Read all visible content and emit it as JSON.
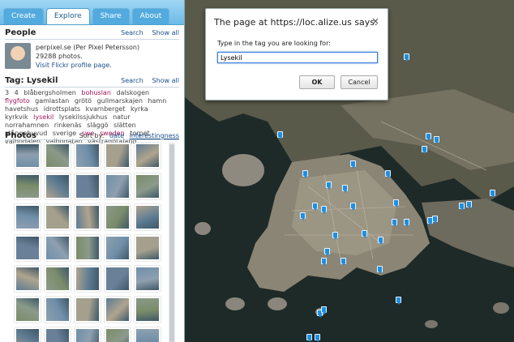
{
  "tabs": [
    "Create",
    "Explore",
    "Share",
    "About"
  ],
  "people": {
    "title": "People",
    "search": "Search",
    "show_all": "Show all",
    "user": "perpixel.se (Per Pixel Petersson)",
    "count": "29288 photos.",
    "profile_link": "Visit Flickr profile page."
  },
  "tag": {
    "title": "Tag: Lysekil",
    "search": "Search",
    "show_all": "Show all",
    "cloud": [
      {
        "t": "3",
        "hot": false
      },
      {
        "t": "4",
        "hot": false
      },
      {
        "t": "blåbergsholmen",
        "hot": false
      },
      {
        "t": "bohuslan",
        "hot": true
      },
      {
        "t": "dalskogen",
        "hot": false
      },
      {
        "t": "flygfoto",
        "hot": true
      },
      {
        "t": "gamlastan",
        "hot": false
      },
      {
        "t": "grötö",
        "hot": false
      },
      {
        "t": "gullmarskajen",
        "hot": false
      },
      {
        "t": "hamn",
        "hot": false
      },
      {
        "t": "havetshus",
        "hot": false
      },
      {
        "t": "idrottsplats",
        "hot": false
      },
      {
        "t": "kvarnberget",
        "hot": false
      },
      {
        "t": "kyrka",
        "hot": false
      },
      {
        "t": "kyrkvik",
        "hot": false
      },
      {
        "t": "lysekil",
        "hot": true
      },
      {
        "t": "lysekilssjukhus",
        "hot": false
      },
      {
        "t": "natur",
        "hot": false
      },
      {
        "t": "norrahamnen",
        "hot": false
      },
      {
        "t": "rinkenäs",
        "hot": false
      },
      {
        "t": "släggö",
        "hot": false
      },
      {
        "t": "slätten",
        "hot": false
      },
      {
        "t": "stångehuvud",
        "hot": false
      },
      {
        "t": "sverige",
        "hot": false
      },
      {
        "t": "swe",
        "hot": true
      },
      {
        "t": "sweden",
        "hot": true
      },
      {
        "t": "torpet",
        "hot": false
      },
      {
        "t": "valbodalen",
        "hot": false
      },
      {
        "t": "valbogatan",
        "hot": false
      },
      {
        "t": "västragötaland",
        "hot": false
      }
    ]
  },
  "photos": {
    "title": "Photos",
    "sort_label": "Sort by:",
    "sort_date": "date",
    "sort_interesting": "interestingness"
  },
  "dialog": {
    "title": "The page at https://loc.alize.us says:",
    "close": "×",
    "message": "Type in the tag you are looking for:",
    "value": "Lysekil",
    "ok": "OK",
    "cancel": "Cancel"
  }
}
